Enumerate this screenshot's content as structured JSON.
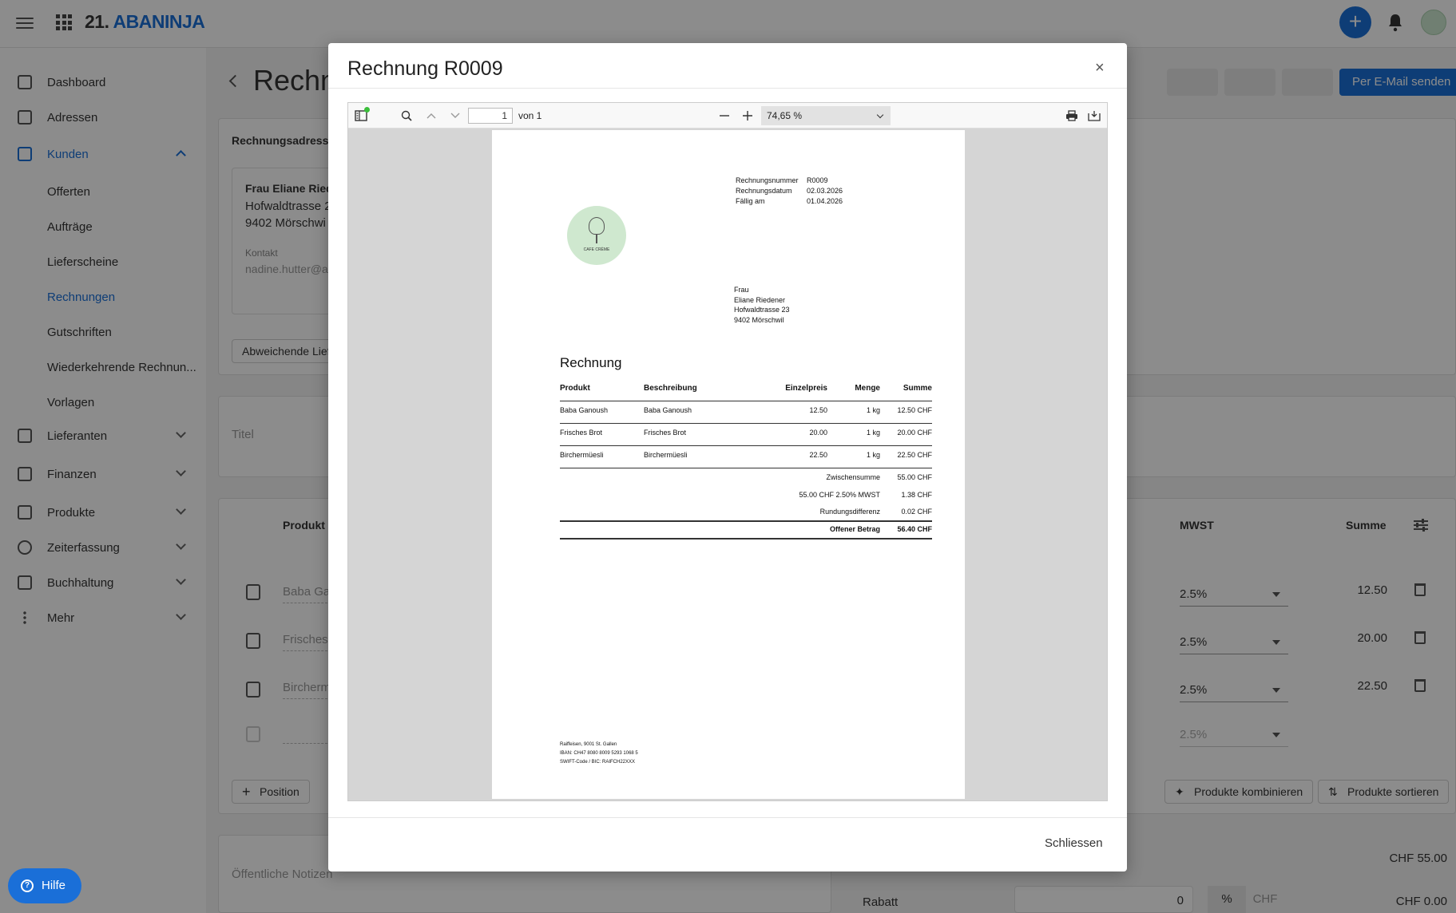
{
  "topbar": {
    "logo_num": "21.",
    "logo_name": "ABANINJA",
    "plus": "+"
  },
  "sidebar": {
    "items": [
      {
        "label": "Dashboard"
      },
      {
        "label": "Adressen"
      },
      {
        "label": "Kunden"
      },
      {
        "label": "Offerten"
      },
      {
        "label": "Aufträge"
      },
      {
        "label": "Lieferscheine"
      },
      {
        "label": "Rechnungen"
      },
      {
        "label": "Gutschriften"
      },
      {
        "label": "Wiederkehrende Rechnun..."
      },
      {
        "label": "Vorlagen"
      },
      {
        "label": "Lieferanten"
      },
      {
        "label": "Finanzen"
      },
      {
        "label": "Produkte"
      },
      {
        "label": "Zeiterfassung"
      },
      {
        "label": "Buchhaltung"
      },
      {
        "label": "Mehr"
      }
    ]
  },
  "main": {
    "title": "Rechn",
    "mail_button": "Per E-Mail senden",
    "address_section": "Rechnungsadress",
    "customer_name": "Frau Eliane Ried",
    "customer_street": "Hofwaldtrasse 2",
    "customer_city": "9402 Mörschwi",
    "contact_label": "Kontakt",
    "contact_email": "nadine.hutter@a",
    "alt_address_btn": "Abweichende Lief",
    "title_label": "Titel",
    "col_product": "Produkt",
    "col_vat": "MWST",
    "col_sum": "Summe",
    "rows": [
      {
        "product": "Baba Ga",
        "vat": "2.5%",
        "sum": "12.50"
      },
      {
        "product": "Frisches",
        "vat": "2.5%",
        "sum": "20.00"
      },
      {
        "product": "Bircherm",
        "vat": "2.5%",
        "sum": "22.50"
      }
    ],
    "empty_vat": "2.5%",
    "position_btn": "Position",
    "combine_btn": "Produkte kombinieren",
    "sort_btn": "Produkte sortieren",
    "public_notes": "Öffentliche Notizen",
    "subtotal_value": "CHF 55.00",
    "discount_label": "Rabatt",
    "discount_input": "0",
    "discount_pct": "%",
    "discount_chf": "CHF",
    "discount_value": "CHF 0.00",
    "help": "Hilfe"
  },
  "modal": {
    "title": "Rechnung R0009",
    "close": "×",
    "close_button": "Schliessen",
    "viewer": {
      "page": "1",
      "of": "von 1",
      "zoom": "74,65 %"
    },
    "pdf": {
      "meta": [
        {
          "label": "Rechnungsnummer",
          "value": "R0009"
        },
        {
          "label": "Rechnungsdatum",
          "value": "02.03.2026"
        },
        {
          "label": "Fällig am",
          "value": "01.04.2026"
        }
      ],
      "logo_text": "CAFE CRÈME",
      "recipient": [
        "Frau",
        "Eliane Riedener",
        "Hofwaldtrasse 23",
        "9402 Mörschwil"
      ],
      "heading": "Rechnung",
      "headers": {
        "product": "Produkt",
        "description": "Beschreibung",
        "unit_price": "Einzelpreis",
        "qty": "Menge",
        "sum": "Summe"
      },
      "items": [
        {
          "product": "Baba Ganoush",
          "description": "Baba Ganoush",
          "unit_price": "12.50",
          "qty": "1 kg",
          "sum": "12.50 CHF"
        },
        {
          "product": "Frisches Brot",
          "description": "Frisches Brot",
          "unit_price": "20.00",
          "qty": "1 kg",
          "sum": "20.00 CHF"
        },
        {
          "product": "Birchermüesli",
          "description": "Birchermüesli",
          "unit_price": "22.50",
          "qty": "1 kg",
          "sum": "22.50 CHF"
        }
      ],
      "totals": [
        {
          "label": "Zwischensumme",
          "value": "55.00 CHF"
        },
        {
          "label": "55.00 CHF 2.50% MWST",
          "value": "1.38 CHF"
        },
        {
          "label": "Rundungsdifferenz",
          "value": "0.02 CHF"
        },
        {
          "label": "Offener Betrag",
          "value": "56.40 CHF"
        }
      ],
      "footer": [
        "Raiffeisen, 9001 St. Gallen",
        "IBAN: CH47 8080 8009 5293 1068 5",
        "SWIFT-Code / BIC: RAIFCH22XXX"
      ]
    }
  },
  "colors": {
    "accent": "#1a6fd8",
    "overlay": "rgba(0,0,0,0.45)"
  }
}
